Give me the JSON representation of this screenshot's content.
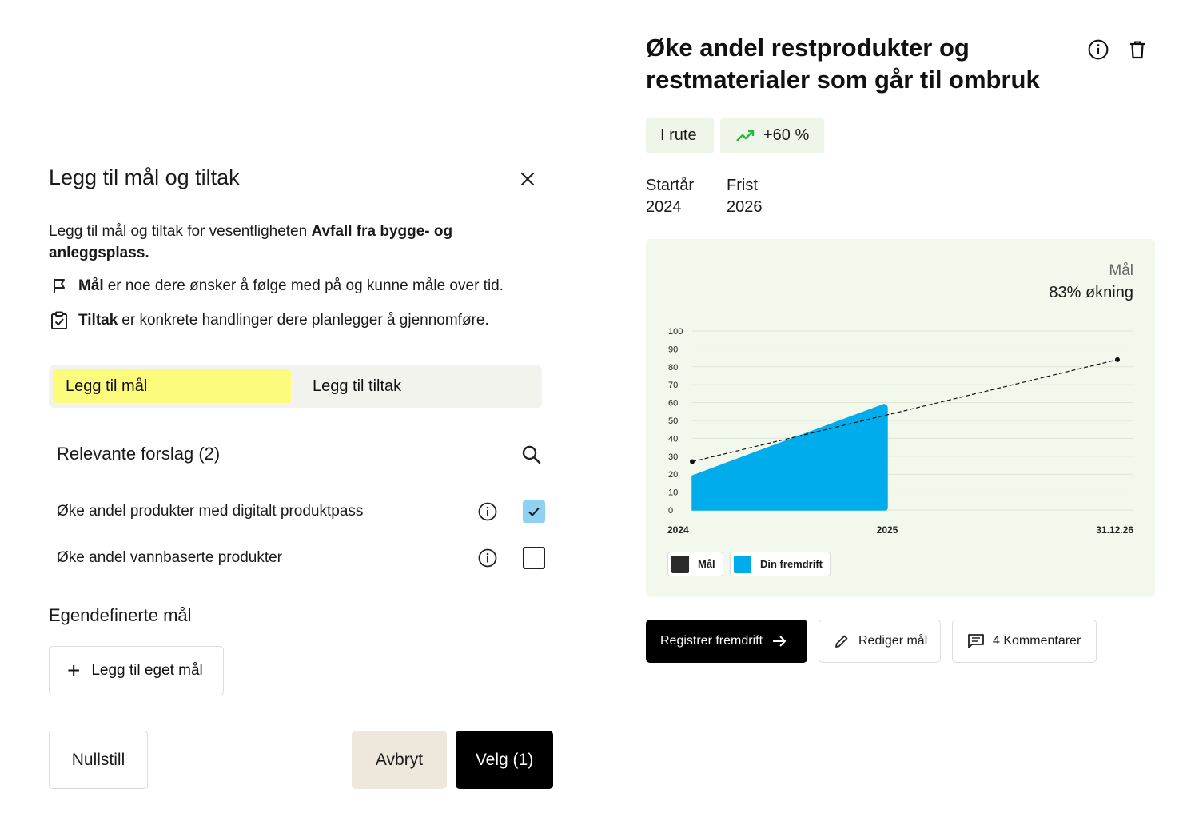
{
  "dialog": {
    "title": "Legg til mål og tiltak",
    "intro_prefix": "Legg til mål og tiltak for vesentligheten ",
    "intro_bold": "Avfall fra bygge- og anleggsplass.",
    "definitions": [
      {
        "icon": "flag-icon",
        "term": "Mål",
        "text": "er noe dere ønsker å følge med på og kunne måle over tid."
      },
      {
        "icon": "clipboard-check-icon",
        "term": "Tiltak",
        "text": "er konkrete handlinger dere planlegger å gjennomføre."
      }
    ],
    "tabs": [
      {
        "label": "Legg til mål",
        "active": true
      },
      {
        "label": "Legg til tiltak",
        "active": false
      }
    ],
    "suggestions_heading": "Relevante forslag (2)",
    "suggestions": [
      {
        "label": "Øke andel produkter med digitalt produktpass",
        "checked": true
      },
      {
        "label": "Øke andel vannbaserte produkter",
        "checked": false
      }
    ],
    "custom_heading": "Egendefinerte mål",
    "add_own_label": "Legg til eget mål",
    "buttons": {
      "reset": "Nullstill",
      "cancel": "Avbryt",
      "select": "Velg (1)"
    }
  },
  "goal": {
    "title": "Øke andel restprodukter og restmaterialer som går til ombruk",
    "status_badge": "I rute",
    "trend_badge": "+60 %",
    "start_label": "Startår",
    "start_value": "2024",
    "deadline_label": "Frist",
    "deadline_value": "2026",
    "target_label": "Mål",
    "target_value": "83% økning",
    "actions": {
      "register": "Registrer fremdrift",
      "edit": "Rediger mål",
      "comments": "4 Kommentarer"
    }
  },
  "colors": {
    "accent_yellow": "#fcfb7c",
    "progress_blue": "#00aceb",
    "card_green": "#f2f8eb",
    "trend_green": "#2fb344"
  },
  "chart_data": {
    "type": "area",
    "y_ticks": [
      0,
      10,
      20,
      30,
      40,
      50,
      60,
      70,
      80,
      90,
      100
    ],
    "ylim": [
      0,
      100
    ],
    "x_labels": [
      "2024",
      "2025",
      "31.12.26"
    ],
    "series": [
      {
        "name": "Mål",
        "type": "line-dashed",
        "points": [
          {
            "x": "2024",
            "y": 27
          },
          {
            "x": "31.12.26",
            "y": 84
          }
        ]
      },
      {
        "name": "Din fremdrift",
        "type": "area",
        "points": [
          {
            "x": "2024",
            "y": 19
          },
          {
            "x": "2025",
            "y": 59
          }
        ]
      }
    ],
    "legend": [
      "Mål",
      "Din fremdrift"
    ]
  }
}
